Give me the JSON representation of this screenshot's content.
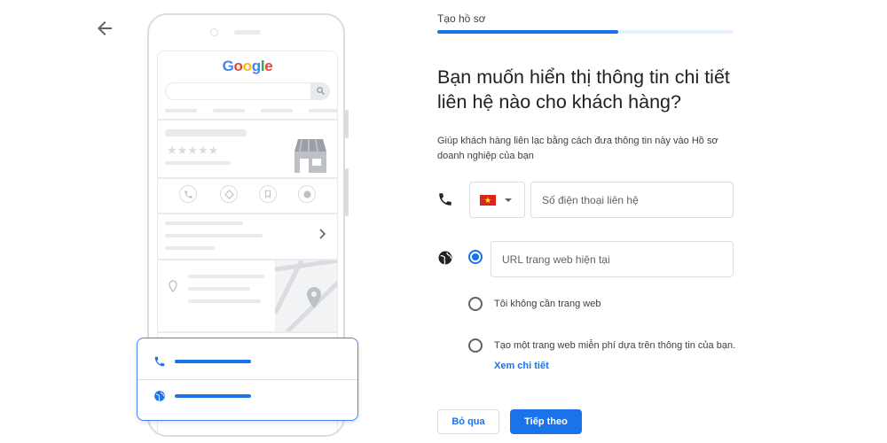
{
  "header": {
    "step_label": "Tạo hồ sơ",
    "progress_fraction": 0.61
  },
  "main": {
    "title_line1": "Bạn muốn hiển thị thông tin chi tiết",
    "title_line2": "liên hệ nào cho khách hàng?",
    "description_line1": "Giúp khách hàng liên lạc bằng cách đưa thông tin này vào Hồ sơ",
    "description_line2": "doanh nghiệp của bạn",
    "phone": {
      "country_flag": "VN",
      "placeholder": "Số điện thoại liên hệ"
    },
    "website": {
      "selected_option": "url",
      "url_placeholder": "URL trang web hiện tại",
      "option_no_website": "Tôi không cần trang web",
      "option_free_website": "Tạo một trang web miễn phí dựa trên thông tin của bạn.",
      "details_link": "Xem chi tiết"
    }
  },
  "footer": {
    "skip_label": "Bỏ qua",
    "next_label": "Tiếp theo"
  },
  "illustration": {
    "logo_letters": [
      "G",
      "o",
      "o",
      "g",
      "l",
      "e"
    ],
    "rating_stars": "★★★★★"
  },
  "colors": {
    "accent": "#1a73e8",
    "border": "#dadce0",
    "placeholder_gray": "#e8eaed",
    "flag_red": "#da251d",
    "flag_star": "#ffff00"
  },
  "icons": {
    "back": "arrow-left-icon",
    "phone": "phone-icon",
    "web": "globe-icon",
    "dropdown": "chevron-down-icon"
  }
}
